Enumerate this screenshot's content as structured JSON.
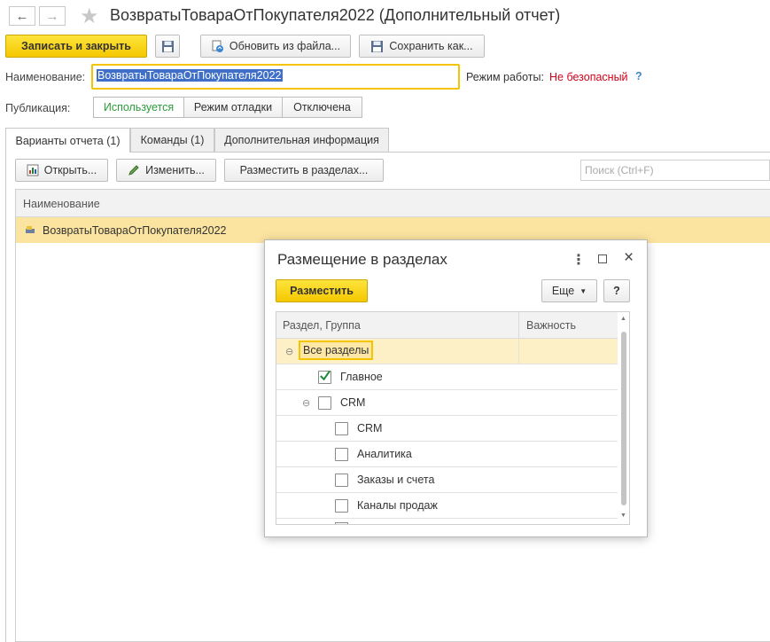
{
  "window": {
    "title": "ВозвратыТовараОтПокупателя2022 (Дополнительный отчет)"
  },
  "toolbar": {
    "save_close": "Записать и закрыть",
    "update_from_file": "Обновить из файла...",
    "save_as": "Сохранить как..."
  },
  "form": {
    "name_label": "Наименование:",
    "name_value": "ВозвратыТовараОтПокупателя2022",
    "mode_label": "Режим работы:",
    "mode_value": "Не безопасный",
    "help": "?",
    "publication_label": "Публикация:",
    "publication_options": [
      "Используется",
      "Режим отладки",
      "Отключена"
    ],
    "publication_selected": "Используется"
  },
  "tabs": [
    "Варианты отчета (1)",
    "Команды (1)",
    "Дополнительная информация"
  ],
  "variants": {
    "open_btn": "Открыть...",
    "edit_btn": "Изменить...",
    "place_btn": "Разместить в разделах...",
    "search_placeholder": "Поиск (Ctrl+F)",
    "column_header": "Наименование",
    "rows": [
      "ВозвратыТовараОтПокупателя2022"
    ]
  },
  "dialog": {
    "title": "Размещение в разделах",
    "place_btn": "Разместить",
    "more_btn": "Еще",
    "help_btn": "?",
    "col_section": "Раздел, Группа",
    "col_importance": "Важность",
    "tree": [
      {
        "label": "Все разделы",
        "checked": null,
        "toggle": "⊖",
        "level": 0
      },
      {
        "label": "Главное",
        "checked": true,
        "toggle": "",
        "level": 1
      },
      {
        "label": "CRM",
        "checked": false,
        "toggle": "⊖",
        "level": 1
      },
      {
        "label": "CRM",
        "checked": false,
        "toggle": "",
        "level": 2
      },
      {
        "label": "Аналитика",
        "checked": false,
        "toggle": "",
        "level": 2
      },
      {
        "label": "Заказы и счета",
        "checked": false,
        "toggle": "",
        "level": 2
      },
      {
        "label": "Каналы продаж",
        "checked": false,
        "toggle": "",
        "level": 2
      }
    ]
  },
  "colors": {
    "accent_yellow": "#f5c800",
    "selection_row": "#fbe3a0",
    "danger": "#d0021b",
    "active_green": "#2a9d3a"
  }
}
